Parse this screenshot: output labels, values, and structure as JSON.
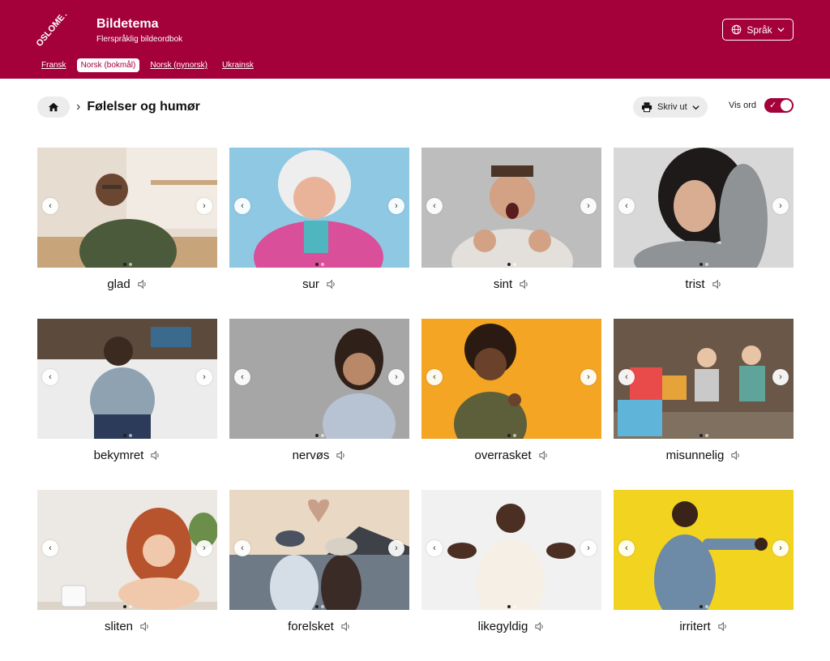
{
  "header": {
    "logo_text": "OSLOMET",
    "title": "Bildetema",
    "subtitle": "Flerspråklig bildeordbok",
    "language_button": "Språk",
    "languages": [
      {
        "label": "Fransk",
        "active": false
      },
      {
        "label": "Norsk (bokmål)",
        "active": true
      },
      {
        "label": "Norsk (nynorsk)",
        "active": false
      },
      {
        "label": "Ukrainsk",
        "active": false
      }
    ],
    "brand_color": "#a4003a"
  },
  "toolbar": {
    "breadcrumb_title": "Følelser og humør",
    "print_label": "Skriv ut",
    "show_words_label": "Vis ord",
    "show_words_on": true
  },
  "cards": [
    {
      "word": "glad"
    },
    {
      "word": "sur"
    },
    {
      "word": "sint"
    },
    {
      "word": "trist"
    },
    {
      "word": "bekymret"
    },
    {
      "word": "nervøs"
    },
    {
      "word": "overrasket"
    },
    {
      "word": "misunnelig"
    },
    {
      "word": "sliten"
    },
    {
      "word": "forelsket"
    },
    {
      "word": "likegyldig"
    },
    {
      "word": "irritert"
    }
  ]
}
